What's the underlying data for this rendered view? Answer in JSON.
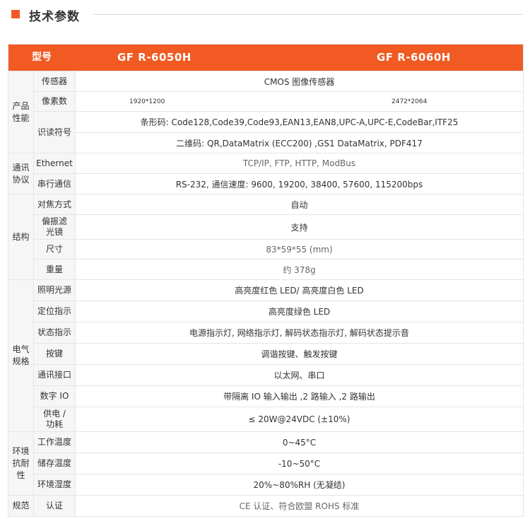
{
  "header": {
    "title": "技术参数"
  },
  "table": {
    "head": {
      "label": "型号",
      "models": [
        "GF R-6050H",
        "GF R-6060H"
      ]
    },
    "groups": [
      {
        "name": "产品\n性能",
        "rows": [
          {
            "label": "传感器",
            "value": "CMOS 图像传感器"
          },
          {
            "label": "像素数",
            "values": [
              "1920*1200",
              "2472*2064"
            ]
          },
          {
            "label": "识读符号",
            "value": "条形码: Code128,Code39,Code93,EAN13,EAN8,UPC-A,UPC-E,CodeBar,ITF25",
            "value2": "二维码: QR,DataMatrix (ECC200) ,GS1 DataMatrix, PDF417"
          }
        ]
      },
      {
        "name": "通讯\n协议",
        "rows": [
          {
            "label": "Ethernet",
            "value": "TCP/IP, FTP, HTTP, ModBus"
          },
          {
            "label": "串行通信",
            "value": "RS-232, 通信速度: 9600, 19200, 38400, 57600, 115200bps"
          }
        ]
      },
      {
        "name": "结构",
        "rows": [
          {
            "label": "对焦方式",
            "value": "自动"
          },
          {
            "label": "偏振滤\n光镜",
            "value": "支持"
          },
          {
            "label": "尺寸",
            "value": "83*59*55 (mm)"
          },
          {
            "label": "重量",
            "value": "约 378g"
          }
        ]
      },
      {
        "name": "电气\n规格",
        "rows": [
          {
            "label": "照明光源",
            "value": "高亮度红色 LED/ 高亮度白色 LED"
          },
          {
            "label": "定位指示",
            "value": "高亮度绿色 LED"
          },
          {
            "label": "状态指示",
            "value": "电源指示灯, 网络指示灯, 解码状态指示灯, 解码状态提示音"
          },
          {
            "label": "按键",
            "value": "调谐按键、触发按键"
          },
          {
            "label": "通讯接口",
            "value": "以太网、串口"
          },
          {
            "label": "数字 IO",
            "value": "带隔离 IO 输入输出 ,2 路输入 ,2 路输出"
          },
          {
            "label": "供电 /\n功耗",
            "value": "≤ 20W@24VDC (±10%)"
          }
        ]
      },
      {
        "name": "环境\n抗耐\n性",
        "rows": [
          {
            "label": "工作温度",
            "value": "0~45°C"
          },
          {
            "label": "储存温度",
            "value": "-10~50°C"
          },
          {
            "label": "环境湿度",
            "value": "20%~80%RH (无凝结)"
          }
        ]
      },
      {
        "name": "规范",
        "rows": [
          {
            "label": "认证",
            "value": "CE 认证、符合欧盟 ROHS 标准"
          }
        ]
      }
    ]
  }
}
